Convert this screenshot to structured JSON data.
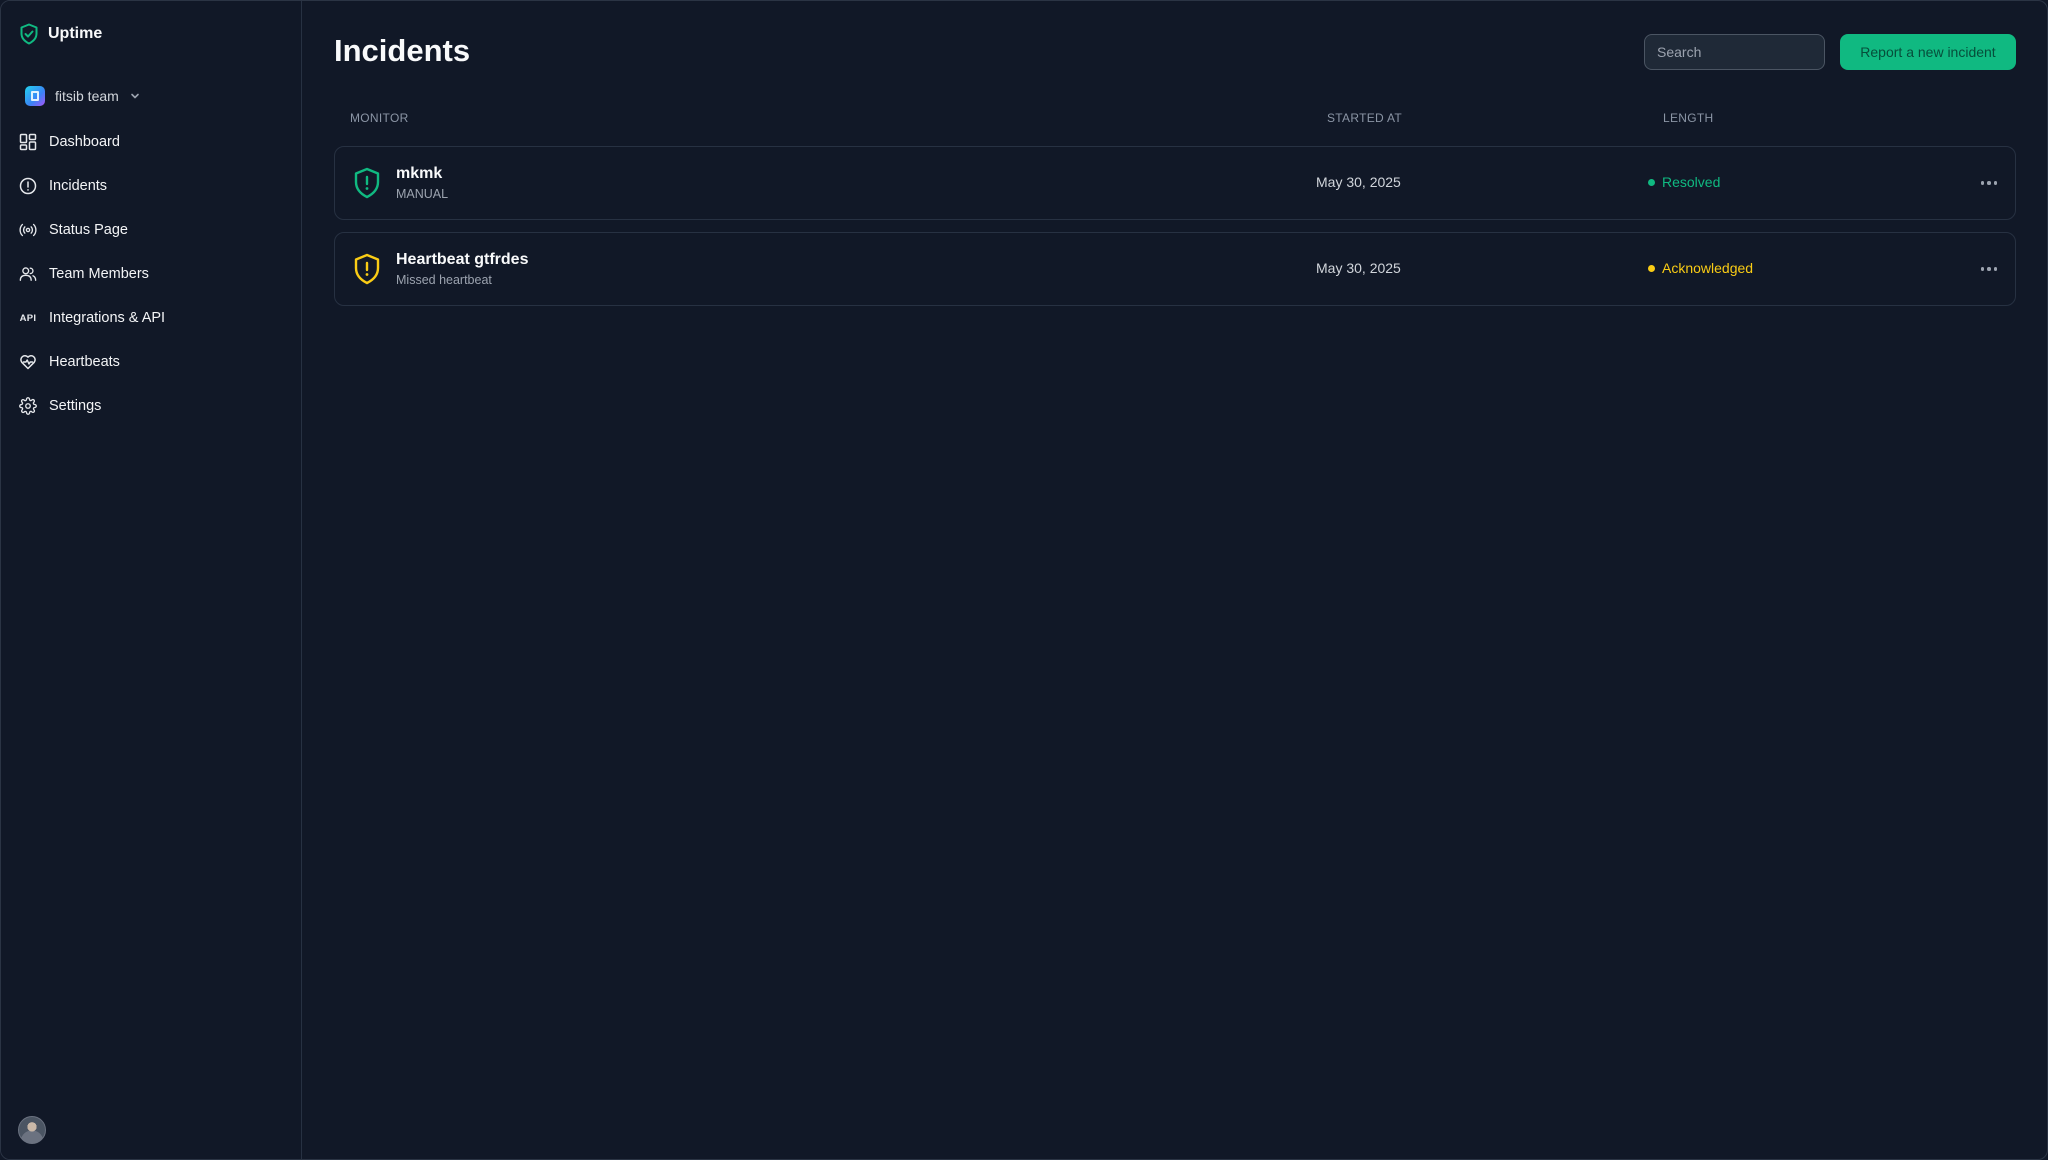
{
  "app": {
    "name": "Uptime"
  },
  "sidebar": {
    "team": "fitsib team",
    "items": [
      {
        "label": "Dashboard",
        "icon": "dashboard-icon"
      },
      {
        "label": "Incidents",
        "icon": "alert-circle-icon"
      },
      {
        "label": "Status Page",
        "icon": "broadcast-icon"
      },
      {
        "label": "Team Members",
        "icon": "users-icon"
      },
      {
        "label": "Integrations & API",
        "icon": "api-icon",
        "glyph": "API"
      },
      {
        "label": "Heartbeats",
        "icon": "heartbeat-icon"
      },
      {
        "label": "Settings",
        "icon": "gear-icon"
      }
    ]
  },
  "header": {
    "title": "Incidents",
    "search_placeholder": "Search",
    "report_label": "Report a new incident"
  },
  "table": {
    "columns": [
      "MONITOR",
      "STARTED AT",
      "LENGTH"
    ],
    "rows": [
      {
        "title": "mkmk",
        "subtitle": "MANUAL",
        "started_at": "May 30, 2025",
        "status": "Resolved",
        "color": "#10b981"
      },
      {
        "title": "Heartbeat gtfrdes",
        "subtitle": "Missed heartbeat",
        "started_at": "May 30, 2025",
        "status": "Acknowledged",
        "color": "#facc15"
      }
    ]
  },
  "colors": {
    "accent": "#10b981",
    "warning": "#facc15",
    "background": "#111827"
  }
}
